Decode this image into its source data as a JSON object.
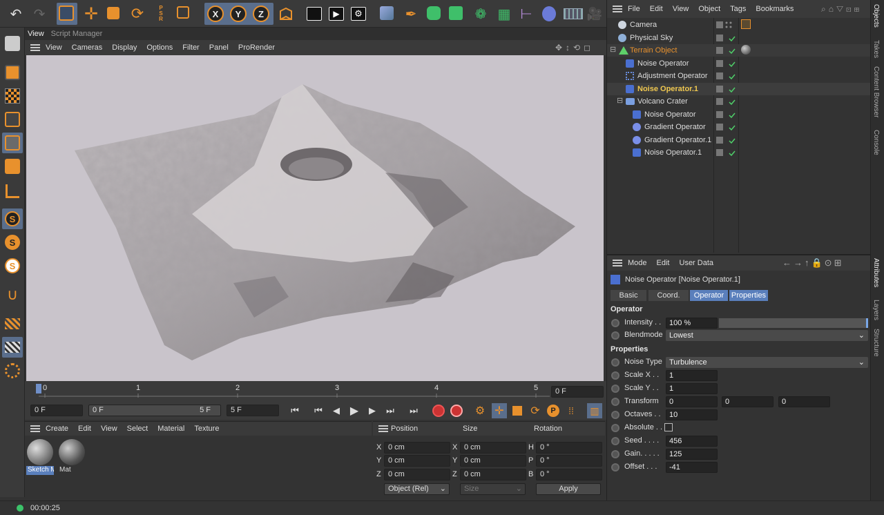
{
  "top_toolbar": {
    "icons": [
      "undo-icon",
      "redo-icon",
      "live-select-icon",
      "move-icon",
      "scale-icon",
      "rotate-icon",
      "psr-icon",
      "rectangle-select-icon",
      "x-axis-icon",
      "y-axis-icon",
      "z-axis-icon",
      "world-coords-icon",
      "render-view-icon",
      "render-picture-viewer-icon",
      "render-settings-icon",
      "cube-icon",
      "pen-icon",
      "subdivision-icon",
      "extrude-icon",
      "array-icon",
      "cloner-icon",
      "deformer-icon",
      "field-icon",
      "floor-icon",
      "camera-icon"
    ],
    "axis_labels": [
      "X",
      "Y",
      "Z"
    ],
    "psr_label": "PSR"
  },
  "viewport": {
    "tabs": [
      "View",
      "Script Manager"
    ],
    "menu": [
      "View",
      "Cameras",
      "Display",
      "Options",
      "Filter",
      "Panel",
      "ProRender"
    ]
  },
  "timeline": {
    "ticks": [
      "0",
      "1",
      "2",
      "3",
      "4",
      "5"
    ],
    "current_frame": "0 F"
  },
  "transport": {
    "start_field": "0 F",
    "range_start": "0 F",
    "range_end": "5 F",
    "end_field": "5 F"
  },
  "material_manager": {
    "menu": [
      "Create",
      "Edit",
      "View",
      "Select",
      "Material",
      "Texture"
    ],
    "materials": [
      {
        "name": "Sketch M",
        "selected": true
      },
      {
        "name": "Mat",
        "selected": false
      }
    ]
  },
  "coordinates": {
    "headers": [
      "Position",
      "Size",
      "Rotation"
    ],
    "rows": [
      {
        "axis": "X",
        "pos": "0 cm",
        "size_axis": "X",
        "size": "0 cm",
        "rot_axis": "H",
        "rot": "0 °"
      },
      {
        "axis": "Y",
        "pos": "0 cm",
        "size_axis": "Y",
        "size": "0 cm",
        "rot_axis": "P",
        "rot": "0 °"
      },
      {
        "axis": "Z",
        "pos": "0 cm",
        "size_axis": "Z",
        "size": "0 cm",
        "rot_axis": "B",
        "rot": "0 °"
      }
    ],
    "mode": "Object (Rel)",
    "size_mode": "Size",
    "apply": "Apply"
  },
  "status": {
    "time": "00:00:25",
    "indicator_color": "#3cc36a"
  },
  "objects": {
    "menu": [
      "File",
      "Edit",
      "View",
      "Object",
      "Tags",
      "Bookmarks"
    ],
    "items": [
      {
        "name": "Camera",
        "indent": 1,
        "icon": "camera-icon",
        "color": "#cfd6e0",
        "highlight": false
      },
      {
        "name": "Physical Sky",
        "indent": 1,
        "icon": "sky-icon",
        "color": "#8fb0d8",
        "highlight": false
      },
      {
        "name": "Terrain Object",
        "indent": 0,
        "icon": "terrain-icon",
        "color": "#e8912d",
        "highlight": true
      },
      {
        "name": "Noise Operator",
        "indent": 2,
        "icon": "noise-icon",
        "color": "#ddd",
        "highlight": false
      },
      {
        "name": "Adjustment Operator",
        "indent": 2,
        "icon": "adjust-icon",
        "color": "#ddd",
        "highlight": false
      },
      {
        "name": "Noise Operator.1",
        "indent": 2,
        "icon": "noise-icon",
        "color": "#f0c850",
        "highlight": false
      },
      {
        "name": "Volcano Crater",
        "indent": 1,
        "icon": "folder-icon",
        "color": "#ddd",
        "highlight": false
      },
      {
        "name": "Noise Operator",
        "indent": 3,
        "icon": "noise-icon",
        "color": "#ddd",
        "highlight": false
      },
      {
        "name": "Gradient Operator",
        "indent": 3,
        "icon": "gradient-icon",
        "color": "#ddd",
        "highlight": false
      },
      {
        "name": "Gradient Operator.1",
        "indent": 3,
        "icon": "gradient-icon",
        "color": "#ddd",
        "highlight": false
      },
      {
        "name": "Noise Operator.1",
        "indent": 3,
        "icon": "noise-icon",
        "color": "#ddd",
        "highlight": false
      }
    ]
  },
  "attributes": {
    "menu": [
      "Mode",
      "Edit",
      "User Data"
    ],
    "title": "Noise Operator [Noise Operator.1]",
    "tabs": [
      {
        "label": "Basic",
        "active": false
      },
      {
        "label": "Coord.",
        "active": false
      },
      {
        "label": "Operator",
        "active": true
      },
      {
        "label": "Properties",
        "active": true
      }
    ],
    "section_operator": "Operator",
    "intensity_label": "Intensity . .",
    "intensity": "100 %",
    "blendmode_label": "Blendmode",
    "blendmode": "Lowest",
    "section_properties": "Properties",
    "noisetype_label": "Noise Type",
    "noisetype": "Turbulence",
    "scalex_label": "Scale X . .",
    "scalex": "1",
    "scaley_label": "Scale Y . .",
    "scaley": "1",
    "transform_label": "Transform",
    "transform": [
      "0",
      "0",
      "0"
    ],
    "octaves_label": "Octaves . .",
    "octaves": "10",
    "absolute_label": "Absolute . .",
    "seed_label": "Seed . . . .",
    "seed": "456",
    "gain_label": "Gain. . . . .",
    "gain": "125",
    "offset_label": "Offset . . .",
    "offset": "-41"
  },
  "side_tabs": [
    "Objects",
    "Takes",
    "Content Browser",
    "Console",
    "Attributes",
    "Layers",
    "Structure"
  ]
}
